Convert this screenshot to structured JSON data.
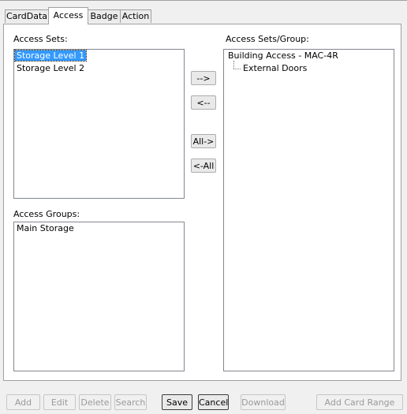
{
  "tabs": [
    {
      "label": "CardData",
      "active": false
    },
    {
      "label": "Access",
      "active": true
    },
    {
      "label": "Badge",
      "active": false
    },
    {
      "label": "Action",
      "active": false
    }
  ],
  "access_sets": {
    "label": "Access Sets:",
    "items": [
      "Storage Level 1",
      "Storage Level 2"
    ],
    "selected": "Storage Level 1"
  },
  "access_groups": {
    "label": "Access Groups:",
    "items": [
      "Main Storage"
    ]
  },
  "assigned": {
    "label": "Access Sets/Group:",
    "root": "Building Access - MAC-4R",
    "children": [
      "External Doors"
    ]
  },
  "transfer_buttons": {
    "add": "-->",
    "remove": "<--",
    "add_all": "All->",
    "remove_all": "<-All"
  },
  "footer_buttons": {
    "add": "Add",
    "edit": "Edit",
    "delete": "Delete",
    "search": "Search",
    "save": "Save",
    "cancel": "Cancel",
    "download": "Download",
    "add_card_range": "Add Card Range"
  },
  "colors": {
    "selection": "#3399ff",
    "window_bg": "#f0f0f0",
    "panel_border": "#a0a0a0"
  }
}
